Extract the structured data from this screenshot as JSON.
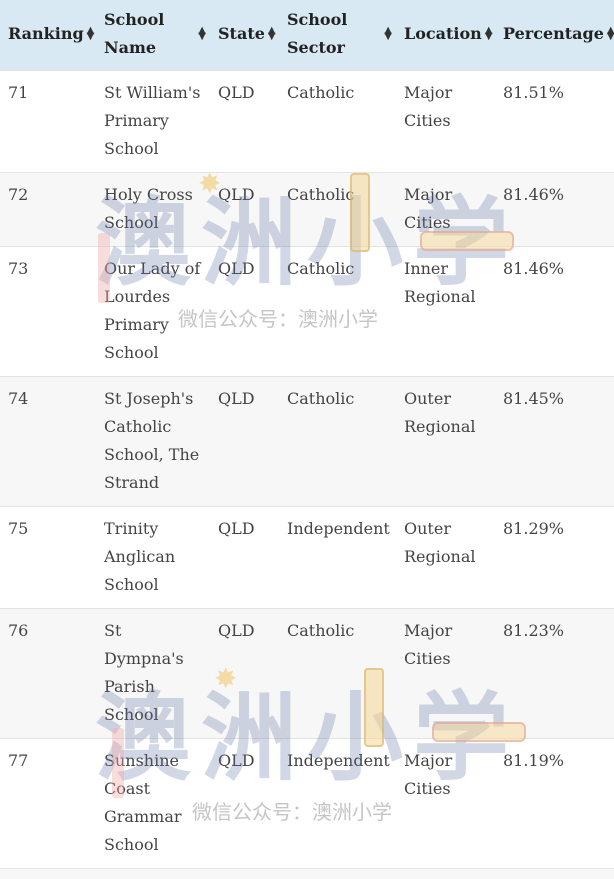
{
  "table": {
    "columns": [
      {
        "key": "ranking",
        "label": "Ranking",
        "sort_icon": "sort-both-icon"
      },
      {
        "key": "school_name",
        "label": "School Name",
        "sort_icon": "sort-both-icon"
      },
      {
        "key": "state",
        "label": "State",
        "sort_icon": "sort-both-icon"
      },
      {
        "key": "school_sector",
        "label": "School Sector",
        "sort_icon": "sort-both-icon"
      },
      {
        "key": "location",
        "label": "Location",
        "sort_icon": "sort-both-icon"
      },
      {
        "key": "percentage",
        "label": "Percentage",
        "sort_icon": "sort-both-icon"
      }
    ],
    "rows": [
      {
        "ranking": "71",
        "school_name": "St William's Primary School",
        "state": "QLD",
        "school_sector": "Catholic",
        "location": "Major Cities",
        "percentage": "81.51%"
      },
      {
        "ranking": "72",
        "school_name": "Holy Cross School",
        "state": "QLD",
        "school_sector": "Catholic",
        "location": "Major Cities",
        "percentage": "81.46%"
      },
      {
        "ranking": "73",
        "school_name": "Our Lady of Lourdes Primary School",
        "state": "QLD",
        "school_sector": "Catholic",
        "location": "Inner Regional",
        "percentage": "81.46%"
      },
      {
        "ranking": "74",
        "school_name": "St Joseph's Catholic School, The Strand",
        "state": "QLD",
        "school_sector": "Catholic",
        "location": "Outer Regional",
        "percentage": "81.45%"
      },
      {
        "ranking": "75",
        "school_name": "Trinity Anglican School",
        "state": "QLD",
        "school_sector": "Independent",
        "location": "Outer Regional",
        "percentage": "81.29%"
      },
      {
        "ranking": "76",
        "school_name": "St Dympna's Parish School",
        "state": "QLD",
        "school_sector": "Catholic",
        "location": "Major Cities",
        "percentage": "81.23%"
      },
      {
        "ranking": "77",
        "school_name": "Sunshine Coast Grammar School",
        "state": "QLD",
        "school_sector": "Independent",
        "location": "Major Cities",
        "percentage": "81.19%"
      }
    ]
  },
  "watermark": {
    "logo_text": "澳洲小学",
    "caption": "微信公众号：澳洲小学"
  },
  "colors": {
    "header_bg": "#d9e9f4",
    "row_alt_bg": "#f7f7f7"
  }
}
